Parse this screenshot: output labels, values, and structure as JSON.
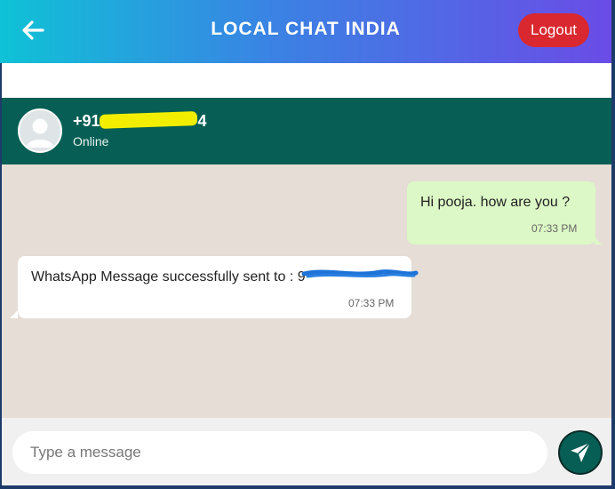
{
  "header": {
    "title": "LOCAL CHAT INDIA",
    "back_icon": "arrow-left-icon",
    "logout_label": "Logout"
  },
  "contact": {
    "name_prefix": "+91",
    "name_suffix": "4",
    "status": "Online",
    "avatar_icon": "user-avatar-icon"
  },
  "messages": [
    {
      "direction": "outgoing",
      "text": "Hi pooja. how are you ?",
      "time": "07:33 PM"
    },
    {
      "direction": "incoming",
      "text": "WhatsApp Message successfully sent to : 9",
      "time": "07:33 PM"
    }
  ],
  "composer": {
    "placeholder": "Type a message",
    "send_icon": "paper-plane-icon"
  },
  "colors": {
    "header_gradient_start": "#0fc2d6",
    "header_gradient_end": "#6a4ce6",
    "logout": "#d9282f",
    "contact_bar": "#075e54",
    "chat_bg": "#e5ddd6",
    "outgoing_bubble": "#dcf8c6",
    "incoming_bubble": "#ffffff"
  }
}
